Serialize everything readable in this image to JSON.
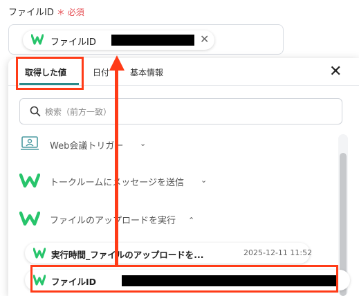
{
  "field": {
    "label": "ファイルID",
    "required_mark": "＊",
    "required_text": "必須"
  },
  "chip": {
    "label": "ファイルID",
    "close_icon": "close-icon"
  },
  "tabs": [
    {
      "label": "取得した値",
      "active": true
    },
    {
      "label": "日付"
    },
    {
      "label": "基本情報"
    }
  ],
  "close_glyph": "✕",
  "search": {
    "placeholder": "検索（前方一致）"
  },
  "sections": [
    {
      "label": "Web会議トリガー",
      "chevron": "⌄",
      "icon": "meeting-icon"
    },
    {
      "label": "トークルームにメッセージを送信",
      "chevron": "⌄",
      "icon": "w-logo-icon"
    },
    {
      "label": "ファイルのアップロードを実行",
      "chevron": "⌃",
      "icon": "w-logo-icon"
    }
  ],
  "rows": [
    {
      "label": "実行時間_ファイルのアップロードを...",
      "time": "2025-12-11 11:52"
    },
    {
      "label": "ファイルID"
    }
  ],
  "colors": {
    "accent": "#2a8a8a",
    "highlight": "#ff3b17",
    "required": "#e5484d",
    "logo_green": "#27c46b"
  }
}
